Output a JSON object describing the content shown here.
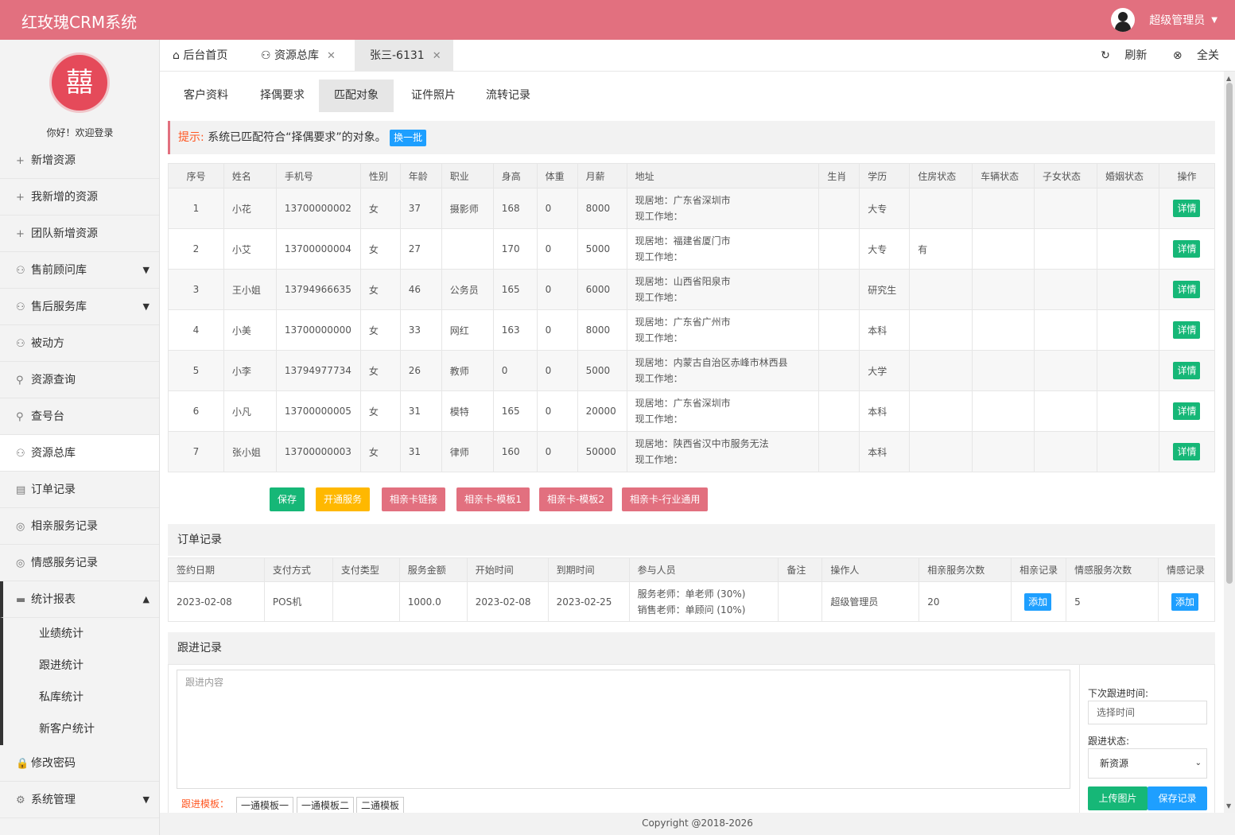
{
  "app": {
    "title": "红玫瑰CRM系统",
    "user": "超级管理员",
    "logo_glyph": "囍"
  },
  "sidebar": {
    "welcome": "你好！欢迎登录",
    "items": [
      {
        "icon": "+",
        "label": "新增资源"
      },
      {
        "icon": "+",
        "label": "我新增的资源"
      },
      {
        "icon": "+",
        "label": "团队新增资源"
      },
      {
        "icon": "⚇",
        "label": "售前顾问库",
        "arrow": "▼"
      },
      {
        "icon": "⚇",
        "label": "售后服务库",
        "arrow": "▼"
      },
      {
        "icon": "⚇",
        "label": "被动方"
      },
      {
        "icon": "⚲",
        "label": "资源查询"
      },
      {
        "icon": "⚲",
        "label": "查号台"
      },
      {
        "icon": "⚇",
        "label": "资源总库"
      },
      {
        "icon": "▤",
        "label": "订单记录"
      },
      {
        "icon": "◎",
        "label": "相亲服务记录"
      },
      {
        "icon": "◎",
        "label": "情感服务记录"
      },
      {
        "icon": "▬",
        "label": "统计报表",
        "arrow": "▲"
      }
    ],
    "sub_items": [
      "业绩统计",
      "跟进统计",
      "私库统计",
      "新客户统计"
    ],
    "bottom_items": [
      {
        "icon": "🔒",
        "label": "修改密码"
      },
      {
        "icon": "⚙",
        "label": "系统管理",
        "arrow": "▼"
      }
    ]
  },
  "tabs": [
    {
      "label": "后台首页",
      "icon": "⌂"
    },
    {
      "label": "资源总库",
      "icon": "⚇",
      "close": "✕"
    },
    {
      "label": "张三-6131",
      "close": "✕"
    }
  ],
  "tab_tools": {
    "refresh": "刷新",
    "close_all": "全关"
  },
  "subtabs": [
    "客户资料",
    "择偶要求",
    "匹配对象",
    "证件照片",
    "流转记录"
  ],
  "tip": {
    "key": "提示:",
    "text": "系统已匹配符合“择偶要求”的对象。",
    "button": "换一批"
  },
  "match_table": {
    "headers": [
      "序号",
      "姓名",
      "手机号",
      "性别",
      "年龄",
      "职业",
      "身高",
      "体重",
      "月薪",
      "地址",
      "生肖",
      "学历",
      "住房状态",
      "车辆状态",
      "子女状态",
      "婚姻状态",
      "操作"
    ],
    "rows": [
      [
        "1",
        "小花",
        "13700000002",
        "女",
        "37",
        "摄影师",
        "168",
        "0",
        "8000",
        "现居地：广东省深圳市",
        "现工作地：",
        "",
        "大专",
        "",
        "",
        "",
        "",
        ""
      ],
      [
        "2",
        "小艾",
        "13700000004",
        "女",
        "27",
        "",
        "170",
        "0",
        "5000",
        "现居地：福建省厦门市",
        "现工作地：",
        "",
        "大专",
        "有",
        "",
        "",
        "",
        ""
      ],
      [
        "3",
        "王小姐",
        "13794966635",
        "女",
        "46",
        "公务员",
        "165",
        "0",
        "6000",
        "现居地：山西省阳泉市",
        "现工作地：",
        "",
        "研究生",
        "",
        "",
        "",
        "",
        ""
      ],
      [
        "4",
        "小美",
        "13700000000",
        "女",
        "33",
        "网红",
        "163",
        "0",
        "8000",
        "现居地：广东省广州市",
        "现工作地：",
        "",
        "本科",
        "",
        "",
        "",
        "",
        ""
      ],
      [
        "5",
        "小李",
        "13794977734",
        "女",
        "26",
        "教师",
        "0",
        "0",
        "5000",
        "现居地：内蒙古自治区赤峰市林西县",
        "现工作地：",
        "",
        "大学",
        "",
        "",
        "",
        "",
        ""
      ],
      [
        "6",
        "小凡",
        "13700000005",
        "女",
        "31",
        "模特",
        "165",
        "0",
        "20000",
        "现居地：广东省深圳市",
        "现工作地：",
        "",
        "本科",
        "",
        "",
        "",
        "",
        ""
      ],
      [
        "7",
        "张小姐",
        "13700000003",
        "女",
        "31",
        "律师",
        "160",
        "0",
        "50000",
        "现居地：陕西省汉中市服务无法",
        "现工作地：",
        "",
        "本科",
        "",
        "",
        "",
        "",
        ""
      ]
    ],
    "detail_label": "详情"
  },
  "actions": [
    "保存",
    "开通服务",
    "相亲卡链接",
    "相亲卡-模板1",
    "相亲卡-模板2",
    "相亲卡-行业通用"
  ],
  "orders": {
    "title": "订单记录",
    "headers": [
      "签约日期",
      "支付方式",
      "支付类型",
      "服务金额",
      "开始时间",
      "到期时间",
      "参与人员",
      "备注",
      "操作人",
      "相亲服务次数",
      "相亲记录",
      "情感服务次数",
      "情感记录"
    ],
    "row": {
      "date": "2023-02-08",
      "pay": "POS机",
      "type": "",
      "amount": "1000.0",
      "start": "2023-02-08",
      "end": "2023-02-25",
      "staff1": "服务老师：单老师 (30%)",
      "staff2": "销售老师：单顾问 (10%)",
      "note": "",
      "operator": "超级管理员",
      "dating_count": "20",
      "add1": "添加",
      "emo_count": "5",
      "add2": "添加"
    }
  },
  "followup": {
    "title": "跟进记录",
    "placeholder": "跟进内容",
    "next_time_label": "下次跟进时间:",
    "next_time_placeholder": "选择时间",
    "status_label": "跟进状态:",
    "status_value": "新资源",
    "upload": "上传图片",
    "save": "保存记录",
    "tpl_label": "跟进模板：",
    "templates": [
      "一通模板一",
      "一通模板二",
      "二通模板"
    ]
  },
  "footer": "Copyright @2018-2026"
}
